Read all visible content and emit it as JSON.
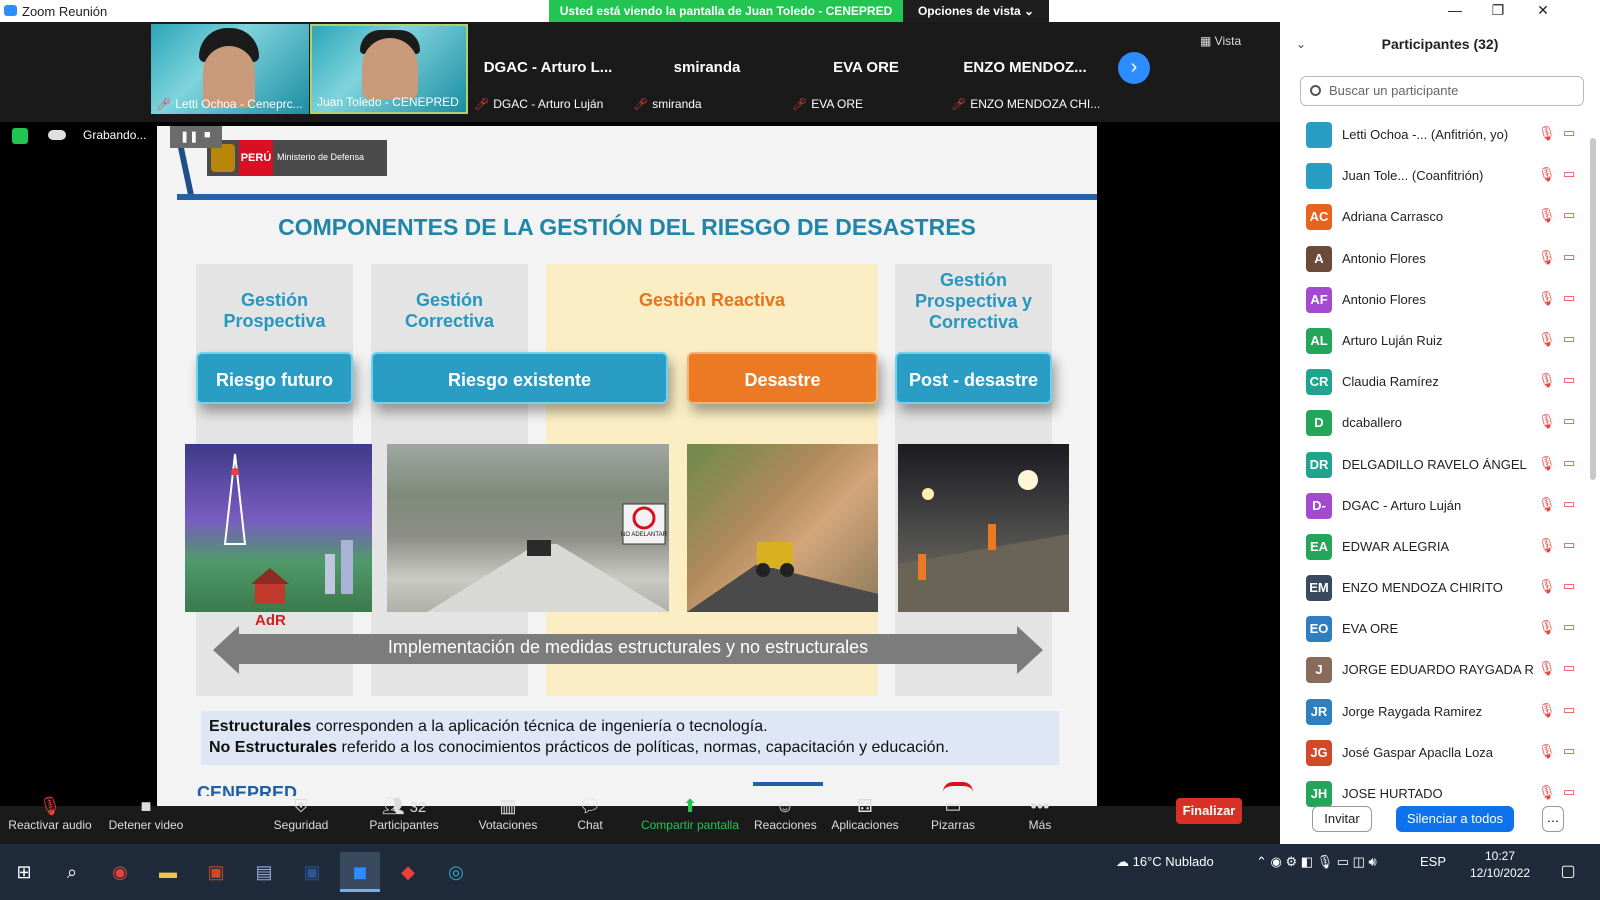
{
  "window": {
    "title": "Zoom Reunión",
    "share_banner": "Usted está viendo la pantalla de Juan Toledo - CENEPRED",
    "view_options": "Opciones de vista ⌄",
    "vista": "Vista"
  },
  "strip": [
    {
      "name": "Letti Ochoa - Ceneprc...",
      "video": true
    },
    {
      "name": "Juan Toledo - CENEPRED",
      "video": true
    },
    {
      "name": "DGAC - Arturo Luján",
      "big": "DGAC - Arturo L..."
    },
    {
      "name": "smiranda",
      "big": "smiranda"
    },
    {
      "name": "EVA ORE",
      "big": "EVA ORE"
    },
    {
      "name": "ENZO MENDOZA CHI...",
      "big": "ENZO  MENDOZ..."
    }
  ],
  "recording": {
    "label": "Grabando..."
  },
  "slide": {
    "peru": "PERÚ",
    "ministry": "Ministerio de Defensa",
    "title": "COMPONENTES DE LA GESTIÓN DEL RIESGO DE DESASTRES",
    "columns": [
      {
        "header": "Gestión Prospectiva",
        "pill": "Riesgo futuro"
      },
      {
        "header": "Gestión Correctiva",
        "pill": "Riesgo existente"
      },
      {
        "header": "Gestión Reactiva",
        "pill": "Desastre"
      },
      {
        "header": "Gestión Prospectiva y Correctiva",
        "pill": "Post - desastre"
      }
    ],
    "adr": "AdR",
    "sign": "NO ADELANTAR",
    "arrow_text": "Implementación de medidas estructurales y no estructurales",
    "def1_bold": "Estructurales",
    "def1_rest": " corresponden a la aplicación técnica de ingeniería o tecnología.",
    "def2_bold": "No Estructurales",
    "def2_rest": " referido a los conocimientos prácticos de políticas, normas, capacitación y educación.",
    "footer_logo": "CENEPRED"
  },
  "participants": {
    "title": "Participantes (32)",
    "search_placeholder": "Buscar un participante",
    "list": [
      {
        "initials": "",
        "name": "Letti Ochoa -... (Anfitrión, yo)",
        "color": "#2a9dc5"
      },
      {
        "initials": "",
        "name": "Juan Tole...  (Coanfitrión)",
        "color": "#2a9dc5"
      },
      {
        "initials": "AC",
        "name": "Adriana Carrasco",
        "color": "#e8631c"
      },
      {
        "initials": "A",
        "name": "Antonio Flores",
        "color": "#6b4a3a"
      },
      {
        "initials": "AF",
        "name": "Antonio Flores",
        "color": "#a24bd1"
      },
      {
        "initials": "AL",
        "name": "Arturo Luján Ruiz",
        "color": "#23a55a"
      },
      {
        "initials": "CR",
        "name": "Claudia Ramírez",
        "color": "#1fa58e"
      },
      {
        "initials": "D",
        "name": "dcaballero",
        "color": "#23a55a"
      },
      {
        "initials": "DR",
        "name": "DELGADILLO RAVELO ÁNGEL",
        "color": "#1fa58e"
      },
      {
        "initials": "D-",
        "name": "DGAC - Arturo Luján",
        "color": "#a24bd1"
      },
      {
        "initials": "EA",
        "name": "EDWAR ALEGRIA",
        "color": "#23a55a"
      },
      {
        "initials": "EM",
        "name": "ENZO MENDOZA CHIRITO",
        "color": "#3a4a5e"
      },
      {
        "initials": "EO",
        "name": "EVA ORE",
        "color": "#2d7fc2"
      },
      {
        "initials": "J",
        "name": "JORGE EDUARDO RAYGADA RA...",
        "color": "#8a6a5a"
      },
      {
        "initials": "JR",
        "name": "Jorge Raygada Ramirez",
        "color": "#2d7fc2"
      },
      {
        "initials": "JG",
        "name": "José Gaspar Apaclla Loza",
        "color": "#d04a2a"
      },
      {
        "initials": "JH",
        "name": "JOSE HURTADO",
        "color": "#23a55a"
      }
    ],
    "invite": "Invitar",
    "mute_all": "Silenciar a todos"
  },
  "toolbar": {
    "audio": "Reactivar audio",
    "video": "Detener video",
    "security": "Seguridad",
    "participants": "Participantes",
    "participants_count": "32",
    "polls": "Votaciones",
    "chat": "Chat",
    "share": "Compartir pantalla",
    "reactions": "Reacciones",
    "apps": "Aplicaciones",
    "whiteboards": "Pizarras",
    "more": "Más",
    "end": "Finalizar"
  },
  "taskbar": {
    "weather": "16°C  Nublado",
    "lang": "ESP",
    "time": "10:27",
    "date": "12/10/2022"
  }
}
